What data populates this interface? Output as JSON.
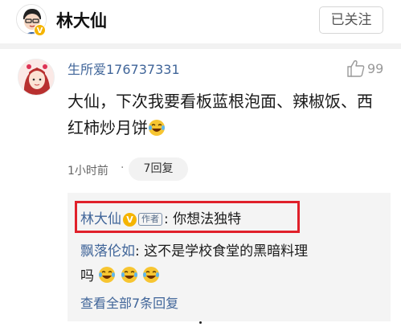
{
  "header": {
    "title": "林大仙",
    "verified_badge": "V",
    "follow_button": "已关注"
  },
  "comment": {
    "username": "生所爱176737331",
    "like_count": "99",
    "text": "大仙，下次我要看板蓝根泡面、辣椒饭、西红柿炒月饼",
    "time": "1小时前",
    "separator": "·",
    "reply_count_label": "7回复",
    "emoji_icon": "laugh-cry-emoji-icon"
  },
  "replies": {
    "items": [
      {
        "name": "林大仙",
        "verified_badge": "V",
        "author_tag": "作者",
        "sep": ": ",
        "text": "你想法独特"
      },
      {
        "name": "飘落伦如",
        "sep": ": ",
        "text_line1": "这不是学校食堂的黑暗料理",
        "text_line2": "吗"
      }
    ],
    "view_all": "查看全部7条回复"
  },
  "colors": {
    "link_blue": "#406599",
    "highlight_red": "#e0202a",
    "badge_gold": "#f5b400",
    "reply_bg": "#f4f4f4"
  }
}
